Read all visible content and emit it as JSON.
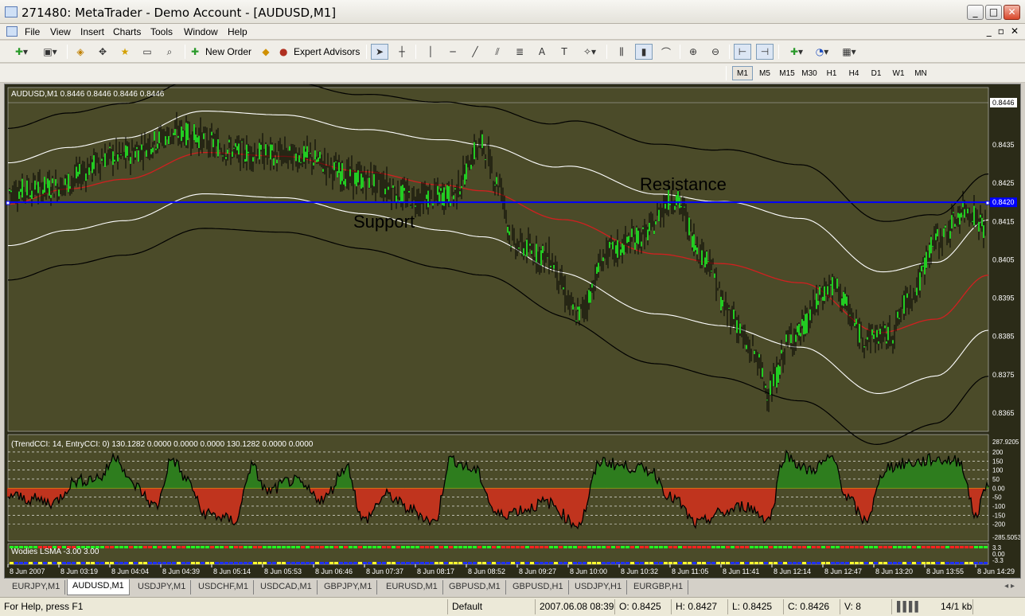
{
  "window": {
    "title": "271480: MetaTrader - Demo Account - [AUDUSD,M1]"
  },
  "menu": [
    "File",
    "View",
    "Insert",
    "Charts",
    "Tools",
    "Window",
    "Help"
  ],
  "toolbar": {
    "new_order": "New Order",
    "expert_advisors": "Expert Advisors"
  },
  "timeframes": [
    "M1",
    "M5",
    "M15",
    "M30",
    "H1",
    "H4",
    "D1",
    "W1",
    "MN"
  ],
  "active_timeframe": "M1",
  "chart": {
    "header": "AUDUSD,M1  0.8446 0.8446 0.8446 0.8446",
    "price_labels": [
      "0.8446",
      "0.8435",
      "0.8425",
      "0.8415",
      "0.8405",
      "0.8395",
      "0.8385",
      "0.8375",
      "0.8365"
    ],
    "horizontal_line_price": "0.8420",
    "annotations": {
      "support": "Support",
      "resistance": "Resistance"
    },
    "cci_header": "(TrendCCI: 14, EntryCCI: 0)  130.1282 0.0000 0.0000 0.0000 130.1282 0.0000 0.0000",
    "cci_top": "287.9205",
    "cci_bottom": "-285.5053",
    "cci_levels": [
      "200",
      "150",
      "100",
      "50",
      "0.00",
      "-50",
      "-100",
      "-150",
      "-200"
    ],
    "lsma_header": "Wodies LSMA -3.00 3.00",
    "lsma_levels": [
      "3.3",
      "0.00",
      "-3.3"
    ],
    "time_labels": [
      "8 Jun 2007",
      "8 Jun 03:19",
      "8 Jun 04:04",
      "8 Jun 04:39",
      "8 Jun 05:14",
      "8 Jun 05:53",
      "8 Jun 06:46",
      "8 Jun 07:37",
      "8 Jun 08:17",
      "8 Jun 08:52",
      "8 Jun 09:27",
      "8 Jun 10:00",
      "8 Jun 10:32",
      "8 Jun 11:05",
      "8 Jun 11:41",
      "8 Jun 12:14",
      "8 Jun 12:47",
      "8 Jun 13:20",
      "8 Jun 13:55",
      "8 Jun 14:29"
    ],
    "colors": {
      "background": "#4a4a2a",
      "ma": "#d02020",
      "band_inner": "#ffffff",
      "band_outer": "#000000",
      "hline": "#0000ff",
      "cci_pos": "#2e7d1e",
      "cci_neg": "#c0341e",
      "cci_line": "#000000",
      "candle_up": "#22cc22"
    }
  },
  "tabs": [
    "EURJPY,M1",
    "AUDUSD,M1",
    "USDJPY,M1",
    "USDCHF,M1",
    "USDCAD,M1",
    "GBPJPY,M1",
    "EURUSD,M1",
    "GBPUSD,M1",
    "GBPUSD,H1",
    "USDJPY,H1",
    "EURGBP,H1"
  ],
  "active_tab": "AUDUSD,M1",
  "status": {
    "help": "For Help, press F1",
    "profile": "Default",
    "datetime": "2007.06.08 08:39",
    "open": "O: 0.8425",
    "high": "H: 0.8427",
    "low": "L: 0.8425",
    "close": "C: 0.8426",
    "volume": "V: 8",
    "traffic": "14/1 kb"
  }
}
